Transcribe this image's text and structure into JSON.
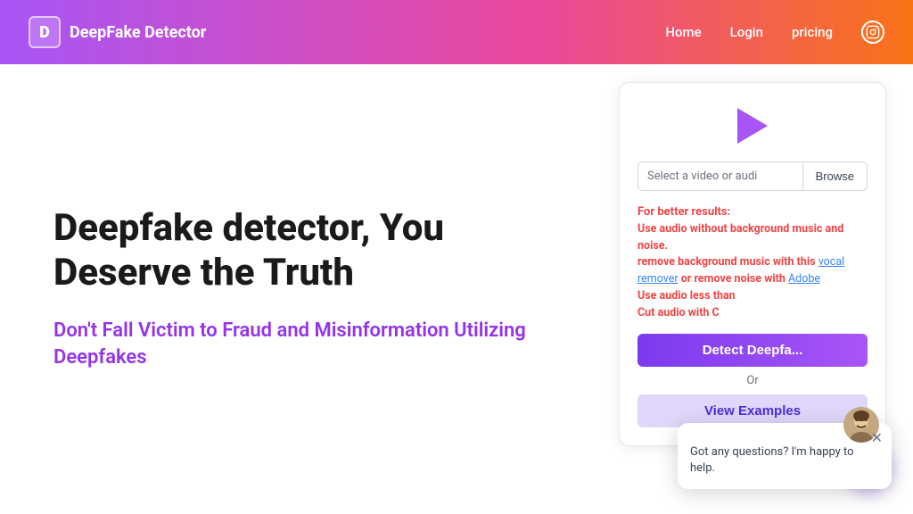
{
  "header": {
    "logo_letter": "D",
    "title": "DeepFake Detector",
    "nav": {
      "home": "Home",
      "login": "Login",
      "pricing": "pricing",
      "instagram_icon": "instagram"
    }
  },
  "hero": {
    "title": "Deepfake detector, You Deserve the Truth",
    "subtitle": "Don't Fall Victim to Fraud and Misinformation Utilizing Deepfakes"
  },
  "card": {
    "file_placeholder": "Select a video or audi",
    "browse_label": "Browse",
    "tips": {
      "for_better": "For better results:",
      "tip1": "Use audio without background music and noise.",
      "tip2_prefix": "remove background music with this ",
      "vocal_remover": "vocal remover",
      "tip2_mid": " or remove noise with ",
      "adobe": "Adobe",
      "tip3_prefix": "Use audio less than",
      "cut_prefix": "Cut audio with C",
      "cut_link": ""
    },
    "detect_button": "Detect Deepfa...",
    "or_text": "Or",
    "examples_button": "View Examples"
  },
  "chat": {
    "avatar": "👩",
    "message": "Got any questions? I'm happy to help."
  }
}
